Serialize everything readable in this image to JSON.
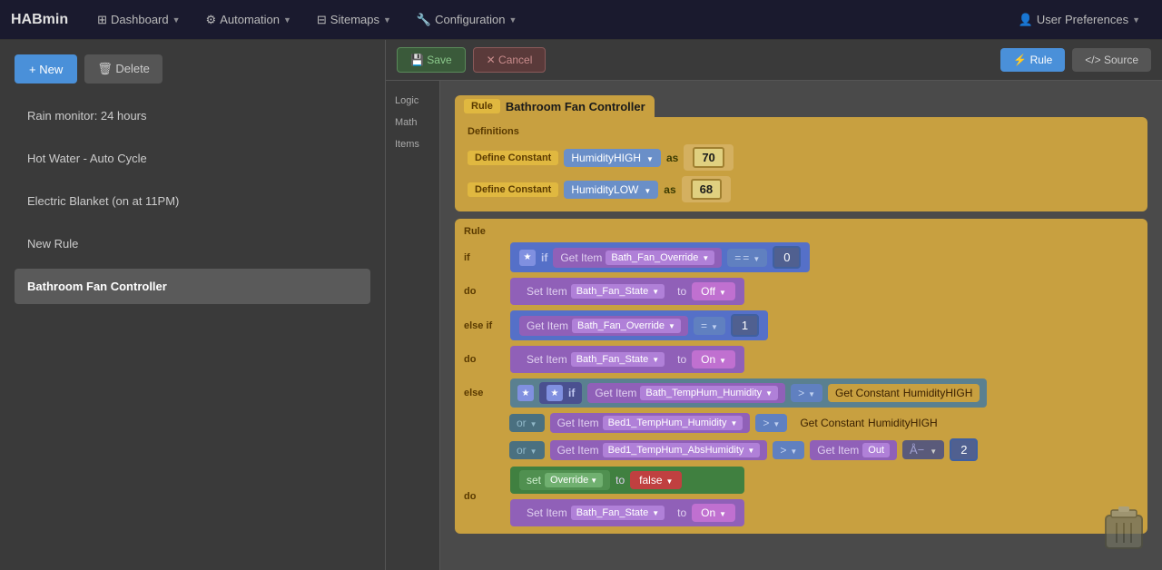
{
  "app": {
    "brand": "HABmin",
    "nav": {
      "items": [
        {
          "label": "Dashboard",
          "icon": "dashboard-icon"
        },
        {
          "label": "Automation",
          "icon": "automation-icon"
        },
        {
          "label": "Sitemaps",
          "icon": "sitemaps-icon"
        },
        {
          "label": "Configuration",
          "icon": "configuration-icon"
        }
      ],
      "user": "User Preferences"
    }
  },
  "sidebar": {
    "new_label": "+ New",
    "delete_label": "🗑 Delete",
    "items": [
      {
        "label": "Rain monitor: 24 hours",
        "active": false
      },
      {
        "label": "Hot Water - Auto Cycle",
        "active": false
      },
      {
        "label": "Electric Blanket (on at 11PM)",
        "active": false
      },
      {
        "label": "New Rule",
        "active": false
      },
      {
        "label": "Bathroom Fan Controller",
        "active": true
      }
    ]
  },
  "toolbar": {
    "save_label": "💾 Save",
    "cancel_label": "✕ Cancel",
    "rule_label": "⚡ Rule",
    "source_label": "</> Source"
  },
  "canvas": {
    "rule_label": "Rule",
    "rule_title": "Bathroom Fan Controller",
    "definitions_label": "Definitions",
    "rule_section_label": "Rule",
    "constants": [
      {
        "label": "Define Constant",
        "name": "HumidityHIGH",
        "as": "as",
        "value": "70"
      },
      {
        "label": "Define Constant",
        "name": "HumidityLOW",
        "as": "as",
        "value": "68"
      }
    ],
    "if_block": {
      "item": "Bath_Fan_Override",
      "op": "=",
      "val": "0"
    },
    "do_block": {
      "item": "Bath_Fan_State",
      "to": "to",
      "val": "Off"
    },
    "else_if_block": {
      "item": "Bath_Fan_Override",
      "op": "=",
      "val": "1"
    },
    "else_if_do_block": {
      "item": "Bath_Fan_State",
      "to": "to",
      "val": "On"
    },
    "else_conditions": [
      {
        "item": "Bath_TempHum_Humidity",
        "op": ">",
        "const": "HumidityHIGH"
      },
      {
        "item": "Bed1_TempHum_Humidity",
        "op": ">",
        "const": "HumidityHIGH"
      },
      {
        "item": "Bed1_TempHum_AbsHumidity",
        "op": ">",
        "sub_item": "Out",
        "suffix": "2"
      }
    ],
    "else_do": {
      "set_var": "Override",
      "to": "to",
      "val": "false",
      "item": "Bath_Fan_State",
      "item_to": "to",
      "item_val": "On"
    },
    "get_item_label": "Get Item",
    "set_item_label": "Set Item",
    "get_constant_label": "Get Constant"
  }
}
